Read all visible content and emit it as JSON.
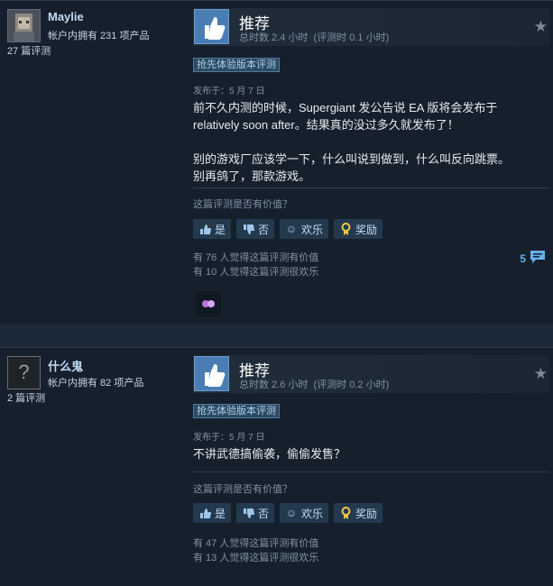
{
  "reviews": [
    {
      "username": "Maylie",
      "products_owned": "帐户内拥有 231 项产品",
      "review_count": "27 篇评测",
      "recommendation": "推荐",
      "hours_total": "总时数 2.4 小时",
      "hours_at_review": "(评测时 0.1 小时)",
      "badge": "抢先体验版本评测",
      "posted": "发布于：5 月 7 日",
      "paragraphs": [
        "前不久内测的时候，Supergiant 发公告说 EA 版将会发布于 relatively soon after。结果真的没过多久就发布了！",
        "别的游戏厂应该学一下，什么叫说到做到，什么叫反向跳票。别再鸽了，那款游戏。"
      ],
      "helpful_question": "这篇评测是否有价值？",
      "buttons": {
        "yes": "是",
        "no": "否",
        "funny": "欢乐",
        "award": "奖励"
      },
      "stats": [
        "有 76 人觉得这篇评测有价值",
        "有 10 人觉得这篇评测很欢乐"
      ],
      "comments": "5"
    },
    {
      "username": "什么鬼",
      "products_owned": "帐户内拥有 82 项产品",
      "review_count": "2 篇评测",
      "recommendation": "推荐",
      "hours_total": "总时数 2.6 小时",
      "hours_at_review": "(评测时 0.2 小时)",
      "badge": "抢先体验版本评测",
      "posted": "发布于：5 月 7 日",
      "paragraphs": [
        "不讲武德搞偷袭，偷偷发售？"
      ],
      "helpful_question": "这篇评测是否有价值？",
      "buttons": {
        "yes": "是",
        "no": "否",
        "funny": "欢乐",
        "award": "奖励"
      },
      "stats": [
        "有 47 人觉得这篇评测有价值",
        "有 13 人觉得这篇评测很欢乐"
      ]
    }
  ],
  "icons": {
    "recommend": "thumbs-up-icon",
    "favorite": "star-icon",
    "comments": "speech-bubble-icon",
    "reaction": "reaction-icon"
  },
  "colors": {
    "accent": "#66b0ea",
    "thumb_bg": "#4a7db3",
    "award": "#f2c64f"
  }
}
